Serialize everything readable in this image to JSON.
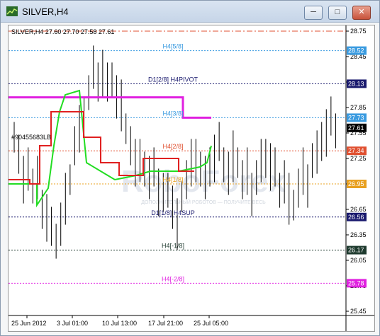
{
  "window": {
    "title": "SILVER,H4",
    "buttons": {
      "minimize": "─",
      "maximize": "□",
      "close": "✕"
    }
  },
  "chart_header": "SILVER,H4  27.60 27.70 27.58 27.61",
  "cursor_label": "#90455683LB",
  "levels": [
    {
      "id": "top",
      "price": "28.75",
      "label": "",
      "color": "#e05030"
    },
    {
      "id": "h4-5-8",
      "price": "28.52",
      "label": "H4[5/8]",
      "color": "#3a9be0"
    },
    {
      "id": "d1-2-8",
      "price": "28.13",
      "label": "D1[2/8] H4PIVOT",
      "color": "#1a1a6e"
    },
    {
      "id": "h4-3-8",
      "price": "27.73",
      "label": "H4[3/8]",
      "color": "#3a9be0"
    },
    {
      "id": "h4-2-8",
      "price": "27.34",
      "label": "H4[2/8]",
      "color": "#e05030"
    },
    {
      "id": "h4-1-8",
      "price": "26.95",
      "label": "H4[1/8]",
      "color": "#e8a020"
    },
    {
      "id": "d1-1-8",
      "price": "26.56",
      "label": "D1[1/8] H4SUP",
      "color": "#1a1a6e"
    },
    {
      "id": "h4-m1-8",
      "price": "26.17",
      "label": "H4[-1/8]",
      "color": "#1e3a2e"
    },
    {
      "id": "h4-m2-8",
      "price": "25.78",
      "label": "H4[-2/8]",
      "color": "#e020e0"
    }
  ],
  "current_price": "27.61",
  "y_ticks": [
    "28.75",
    "28.45",
    "28.15",
    "27.85",
    "27.55",
    "27.25",
    "26.95",
    "26.65",
    "26.35",
    "26.05",
    "25.75",
    "25.45"
  ],
  "x_ticks": [
    "25 Jun 2012",
    "3 Jul 01:00",
    "10 Jul 13:00",
    "17 Jul 21:00",
    "25 Jul 05:00"
  ],
  "watermark": "RoboForex",
  "watermark_sub": "ДОПОЛНИТЕЛЬНЫЙ РОБОТОВ — ПОЛУЧИТЕ ВЕСЬ",
  "colors": {
    "magenta": "#e020e0",
    "green": "#22dd22",
    "red": "#e02020",
    "candle": "#000000"
  }
}
